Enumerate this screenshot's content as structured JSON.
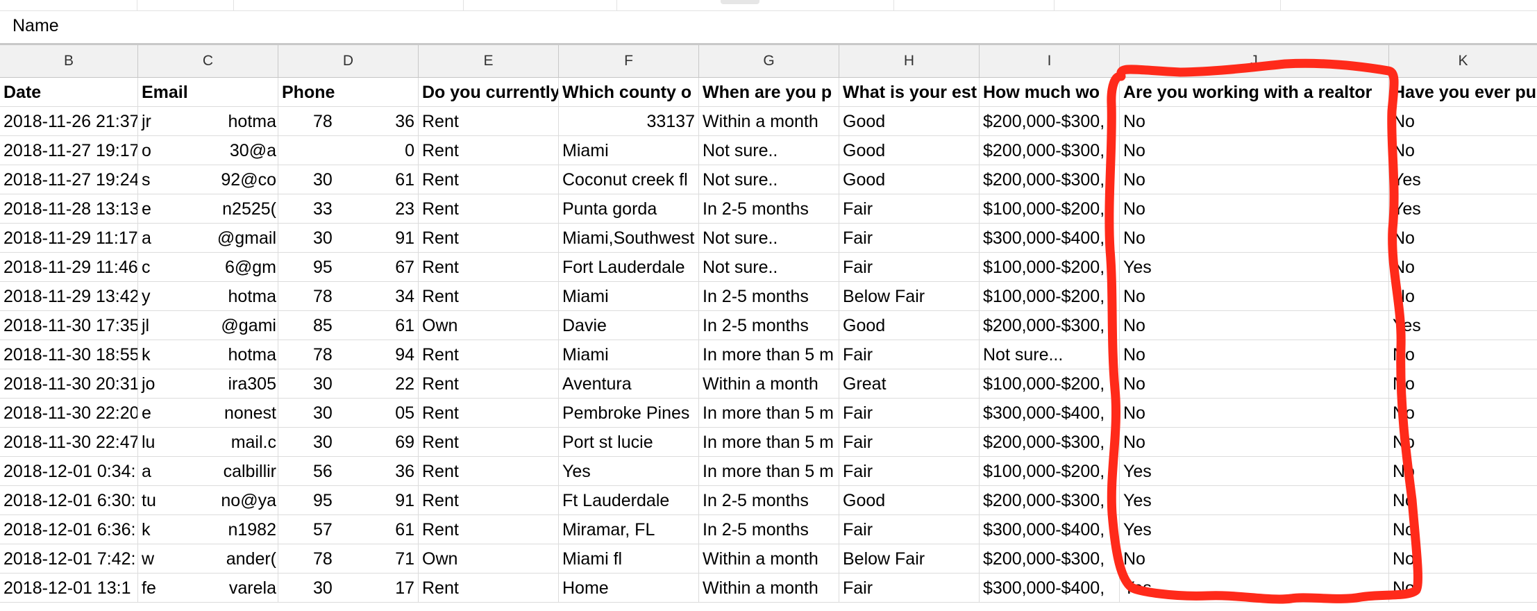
{
  "formula_bar": {
    "cell_content": "Name"
  },
  "columns": [
    "B",
    "C",
    "D",
    "E",
    "F",
    "G",
    "H",
    "I",
    "J",
    "K"
  ],
  "header_row": [
    "Date",
    "Email",
    "Phone",
    "Do you currently",
    "Which county o",
    "When are you p",
    "What is your est",
    "How much wo",
    "Are you working with a realtor",
    "Have you ever pu"
  ],
  "rows": [
    [
      "2018-11-26 21:37",
      "jr",
      "hotma",
      "78",
      "36",
      "Rent",
      "33137",
      "Within a month",
      "Good",
      "$200,000-$300,",
      "No",
      "No"
    ],
    [
      "2018-11-27 19:17",
      "o",
      "30@a",
      "",
      "0",
      "Rent",
      "Miami",
      "Not sure..",
      "Good",
      "$200,000-$300,",
      "No",
      "No"
    ],
    [
      "2018-11-27 19:24",
      "s",
      "92@co",
      "30",
      "61",
      "Rent",
      "Coconut creek fl",
      "Not sure..",
      "Good",
      "$200,000-$300,",
      "No",
      "Yes"
    ],
    [
      "2018-11-28 13:13",
      "e",
      "n2525(",
      "33",
      "23",
      "Rent",
      "Punta gorda",
      "In 2-5 months",
      "Fair",
      "$100,000-$200,",
      "No",
      "Yes"
    ],
    [
      "2018-11-29 11:17",
      "a",
      "@gmail",
      "30",
      "91",
      "Rent",
      "Miami,Southwest",
      "Not sure..",
      "Fair",
      "$300,000-$400,",
      "No",
      "No"
    ],
    [
      "2018-11-29 11:46",
      "c",
      "6@gm",
      "95",
      "67",
      "Rent",
      "Fort Lauderdale",
      "Not sure..",
      "Fair",
      "$100,000-$200,",
      "Yes",
      "No"
    ],
    [
      "2018-11-29 13:42",
      "y",
      "hotma",
      "78",
      "34",
      "Rent",
      "Miami",
      "In 2-5 months",
      "Below Fair",
      "$100,000-$200,",
      "No",
      "No"
    ],
    [
      "2018-11-30 17:35",
      "jl",
      "@gami",
      "85",
      "61",
      "Own",
      "Davie",
      "In 2-5 months",
      "Good",
      "$200,000-$300,",
      "No",
      "Yes"
    ],
    [
      "2018-11-30 18:55",
      "k",
      "hotma",
      "78",
      "94",
      "Rent",
      "Miami",
      "In more than 5 m",
      "Fair",
      "Not sure...",
      "No",
      "No"
    ],
    [
      "2018-11-30 20:31",
      "jo",
      "ira305",
      "30",
      "22",
      "Rent",
      "Aventura",
      "Within a month",
      "Great",
      "$100,000-$200,",
      "No",
      "No"
    ],
    [
      "2018-11-30 22:20",
      "e",
      "nonest",
      "30",
      "05",
      "Rent",
      "Pembroke Pines",
      "In more than 5 m",
      "Fair",
      "$300,000-$400,",
      "No",
      "No"
    ],
    [
      "2018-11-30 22:47",
      "lu",
      "mail.c",
      "30",
      "69",
      "Rent",
      "Port st lucie",
      "In more than 5 m",
      "Fair",
      "$200,000-$300,",
      "No",
      "No"
    ],
    [
      "2018-12-01 0:34:",
      "a",
      "calbillir",
      "56",
      "36",
      "Rent",
      "Yes",
      "In more than 5 m",
      "Fair",
      "$100,000-$200,",
      "Yes",
      "No"
    ],
    [
      "2018-12-01 6:30:",
      "tu",
      "no@ya",
      "95",
      "91",
      "Rent",
      "Ft Lauderdale",
      "In 2-5 months",
      "Good",
      "$200,000-$300,",
      "Yes",
      "No"
    ],
    [
      "2018-12-01 6:36:",
      "k",
      "n1982",
      "57",
      "61",
      "Rent",
      "Miramar, FL",
      "In 2-5 months",
      "Fair",
      "$300,000-$400,",
      "Yes",
      "No"
    ],
    [
      "2018-12-01 7:42:",
      "w",
      "ander(",
      "78",
      "71",
      "Own",
      "Miami fl",
      "Within a month",
      "Below Fair",
      "$200,000-$300,",
      "No",
      "No"
    ],
    [
      "2018-12-01 13:1",
      "fe",
      "varela",
      "30",
      "17",
      "Rent",
      "Home",
      "Within a month",
      "Fair",
      "$300,000-$400,",
      "Yes",
      "No"
    ]
  ],
  "annotation": {
    "color": "#ff2a1a"
  }
}
